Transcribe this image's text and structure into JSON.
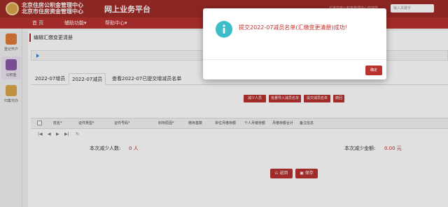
{
  "header": {
    "org_line1": "北京住房公积金管理中心",
    "org_line2": "北京市住房资金管理中心",
    "app_title": "网上业务平台",
    "top_hint": "北京住房公积金管理中心欢迎您",
    "search_placeholder": "输入关键字"
  },
  "nav": {
    "items": [
      "首 页",
      "辅助功能▾",
      "帮助中心▾"
    ]
  },
  "sidebar": {
    "items": [
      "登记开户",
      "公积金",
      "归集代办"
    ]
  },
  "breadcrumb": "编辑汇缴变更清册",
  "tabs": [
    "2022-07增员",
    "2022-07减员",
    "查看2022-07已提交增减员名单"
  ],
  "toolbar": {
    "buttons": [
      "减少人员",
      "批量导入减员名单",
      "提交减员名单",
      "撤回"
    ]
  },
  "table": {
    "columns": [
      "姓名*",
      "证件类型*",
      "证件号码*",
      "封存原因*",
      "缴存基数",
      "单位月缴存额",
      "个人月缴存额",
      "月缴存额合计",
      "备注信息"
    ],
    "pager": [
      "|◀",
      "◀",
      "▶",
      "▶|",
      "↻"
    ]
  },
  "summary": {
    "count_label": "本次减少人数:",
    "count_value": "0 人",
    "amount_label": "本次减少金额:",
    "amount_value": "0.00 元"
  },
  "actions": {
    "back": "返回",
    "save": "保存"
  },
  "modal": {
    "message": "提交2022-07减员名单(汇缴变更清册)成功!",
    "ok_label": "确定",
    "icon": "info-icon"
  },
  "colors": {
    "brand": "#a02c28",
    "nav": "#b8322e",
    "info": "#3dbdc8"
  }
}
